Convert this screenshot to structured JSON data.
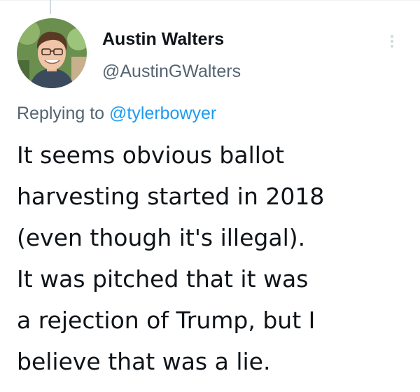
{
  "tweet": {
    "author": {
      "display_name": "Austin Walters",
      "handle": "@AustinGWalters",
      "avatar_icon": "profile-photo"
    },
    "more_icon": "more-vertical-icon",
    "reply": {
      "prefix": "Replying to ",
      "mention": "@tylerbowyer"
    },
    "text_lines": [
      "It seems obvious ballot",
      "harvesting started in 2018",
      "(even though it's illegal).",
      "It was pitched that it was",
      "a rejection of Trump, but I",
      "believe that was a lie."
    ]
  },
  "colors": {
    "text": "#0f1419",
    "secondary": "#536471",
    "link": "#1d9bf0",
    "divider": "#cfd9de"
  }
}
